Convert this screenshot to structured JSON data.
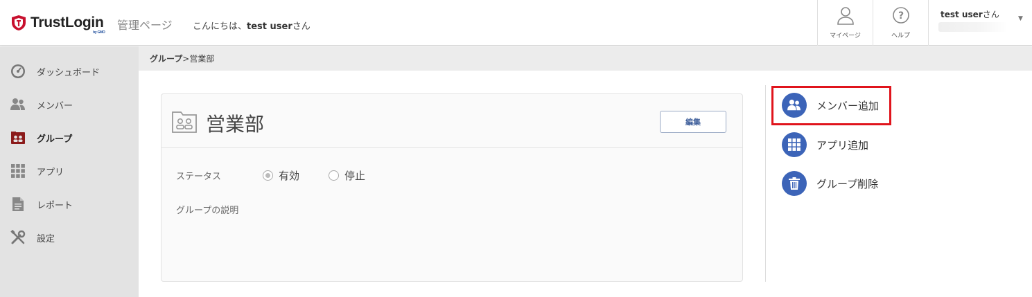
{
  "header": {
    "brand": "TrustLogin",
    "brand_sub": "by GMO",
    "admin_label": "管理ページ",
    "greeting_prefix": "こんにちは、",
    "greeting_user": "test user",
    "greeting_suffix": "さん",
    "mypage_label": "マイページ",
    "help_label": "ヘルプ",
    "user_name": "test user",
    "user_suffix": "さん"
  },
  "sidebar": {
    "items": [
      {
        "label": "ダッシュボード",
        "icon": "dashboard-icon"
      },
      {
        "label": "メンバー",
        "icon": "members-icon"
      },
      {
        "label": "グループ",
        "icon": "group-icon",
        "active": true
      },
      {
        "label": "アプリ",
        "icon": "apps-grid-icon"
      },
      {
        "label": "レポート",
        "icon": "report-icon"
      },
      {
        "label": "設定",
        "icon": "settings-tools-icon"
      }
    ]
  },
  "breadcrumb": {
    "parent": "グループ",
    "separator": " > ",
    "current": "営業部"
  },
  "group": {
    "title": "営業部",
    "edit_label": "編集",
    "status_label": "ステータス",
    "status_options": [
      {
        "label": "有効",
        "selected": true
      },
      {
        "label": "停止",
        "selected": false
      }
    ],
    "description_label": "グループの説明"
  },
  "actions": [
    {
      "label": "メンバー追加",
      "icon": "add-member-icon"
    },
    {
      "label": "アプリ追加",
      "icon": "add-app-grid-icon"
    },
    {
      "label": "グループ削除",
      "icon": "trash-icon"
    }
  ],
  "colors": {
    "accent": "#3c64b8",
    "highlight": "#e0141c",
    "brand_red": "#c8102e",
    "sidebar_bg": "#e3e3e3"
  }
}
